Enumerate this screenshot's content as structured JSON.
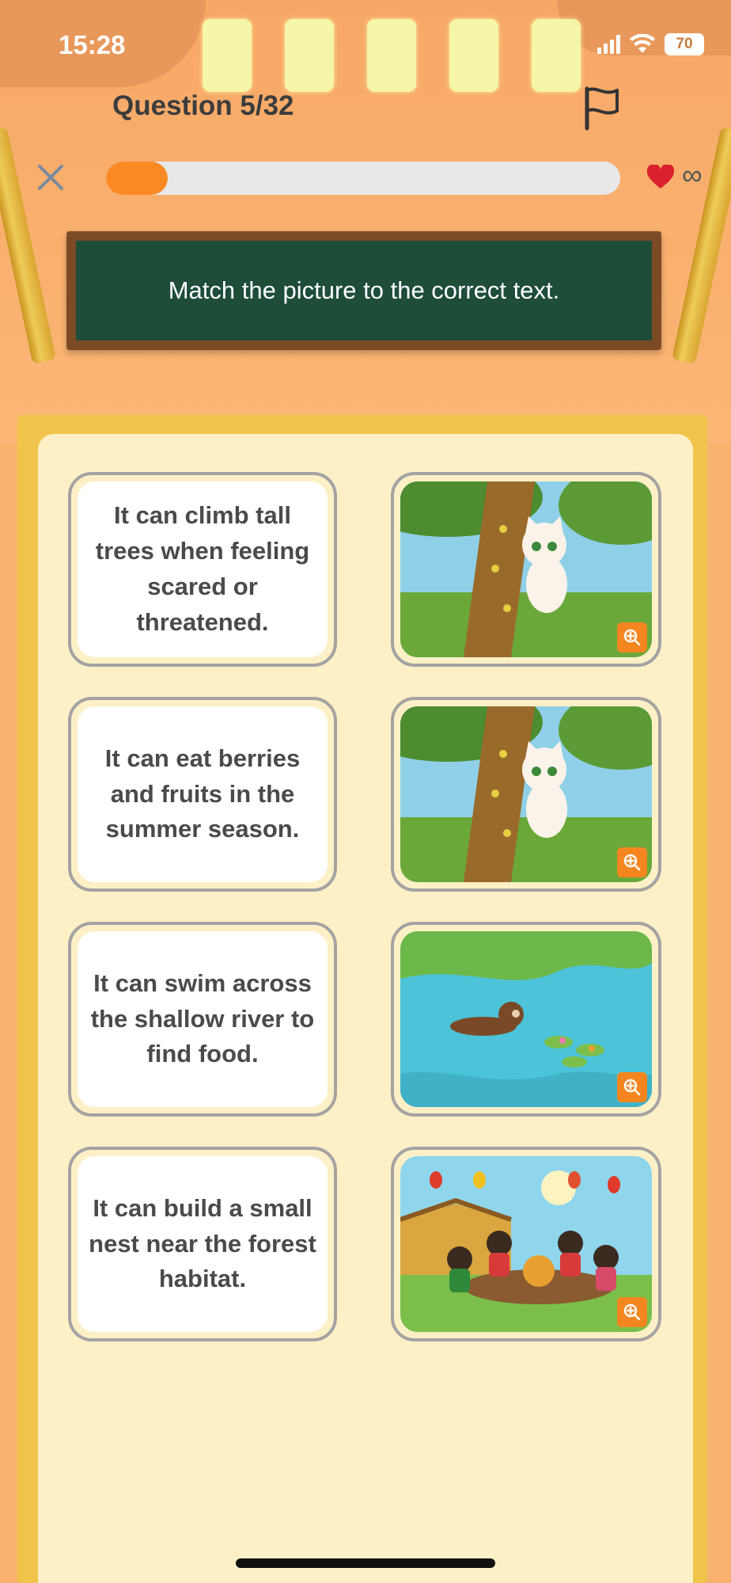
{
  "status_bar": {
    "time": "15:28",
    "battery": "70"
  },
  "header": {
    "question_label": "Question 5/32",
    "progress_fraction": 0.12,
    "lives": "∞"
  },
  "instruction": "Match the picture to the correct text.",
  "texts": [
    "It can climb tall trees when feeling scared or threatened.",
    "It can eat berries and fruits in the summer season.",
    "It can swim across the shallow river to find food.",
    "It can build a small nest near the forest habitat."
  ],
  "images": [
    {
      "subject": "cat-climbing-tree",
      "icon": "zoom-in-icon"
    },
    {
      "subject": "cat-climbing-tree",
      "icon": "zoom-in-icon"
    },
    {
      "subject": "otter-swimming-river",
      "icon": "zoom-in-icon"
    },
    {
      "subject": "children-festival-feast",
      "icon": "zoom-in-icon"
    }
  ],
  "colors": {
    "accent": "#fb8a25",
    "board": "#1e4d3a",
    "heart": "#d9202e"
  }
}
